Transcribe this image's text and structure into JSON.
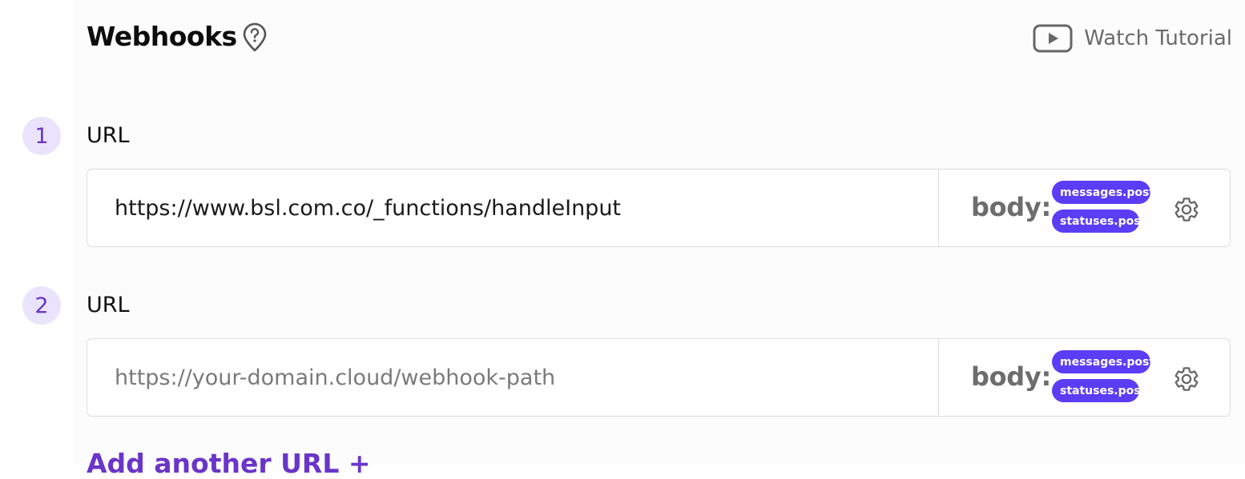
{
  "header": {
    "title": "Webhooks",
    "help_icon": "help-pin-icon",
    "tutorial_label": "Watch Tutorial",
    "tutorial_icon": "play-video-icon"
  },
  "webhooks": [
    {
      "number": "1",
      "label": "URL",
      "value": "https://www.bsl.com.co/_functions/handleInput",
      "placeholder": "",
      "body_label": "body:",
      "events": [
        "messages.post",
        "statuses.post"
      ],
      "settings_icon": "gear-icon"
    },
    {
      "number": "2",
      "label": "URL",
      "value": "",
      "placeholder": "https://your-domain.cloud/webhook-path",
      "body_label": "body:",
      "events": [
        "messages.post",
        "statuses.post"
      ],
      "settings_icon": "gear-icon"
    }
  ],
  "add_link": "Add another URL +",
  "colors": {
    "accent": "#5b3df5",
    "accent_text": "#6a35c9",
    "step_bg": "#e9e4fb"
  }
}
